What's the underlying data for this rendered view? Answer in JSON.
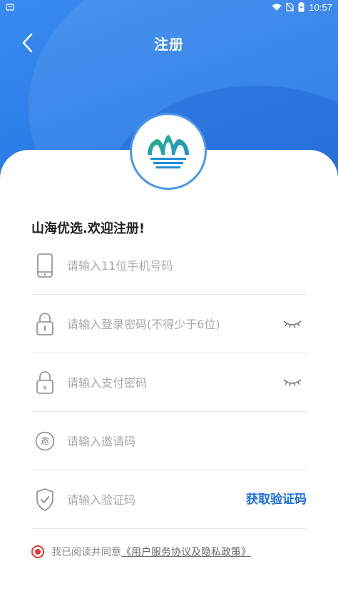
{
  "status_bar": {
    "time": "10:57"
  },
  "nav": {
    "title": "注册",
    "back_icon": "chevron-left-icon"
  },
  "logo": {
    "name": "shanhai-logo"
  },
  "welcome": "山海优选.欢迎注册!",
  "form": {
    "phone": {
      "placeholder": "请输入11位手机号码",
      "value": "",
      "icon": "phone-icon"
    },
    "login_password": {
      "placeholder": "请输入登录密码(不得少于6位)",
      "value": "",
      "icon": "lock-icon",
      "toggle_icon": "eye-closed-icon"
    },
    "pay_password": {
      "placeholder": "请输入支付密码",
      "value": "",
      "icon": "yen-lock-icon",
      "toggle_icon": "eye-closed-icon"
    },
    "invite": {
      "placeholder": "请输入邀请码",
      "value": "",
      "icon": "invite-icon",
      "icon_text": "邀"
    },
    "verify": {
      "placeholder": "请输入验证码",
      "value": "",
      "icon": "shield-check-icon",
      "button_label": "获取验证码"
    }
  },
  "agreement": {
    "prefix": "我已阅读并同意",
    "link": "《用户服务协议及隐私政策》",
    "checked": true
  },
  "colors": {
    "primary": "#1e6fdc",
    "accent_red": "#e53935",
    "header_blue": "#2c7ee8"
  }
}
